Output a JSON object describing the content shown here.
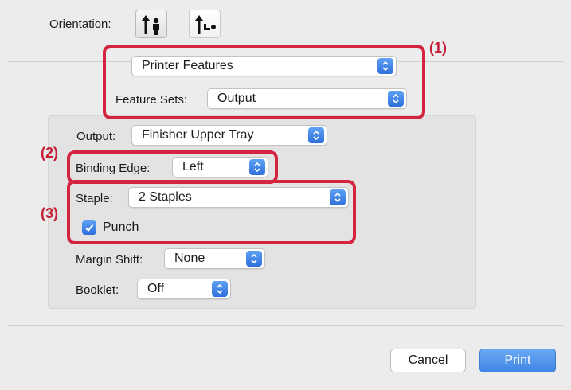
{
  "orientation": {
    "label": "Orientation:",
    "options": [
      {
        "icon": "portrait-orientation-icon",
        "selected": true
      },
      {
        "icon": "landscape-orientation-icon",
        "selected": false
      }
    ]
  },
  "top_section": {
    "panel_select": "Printer Features",
    "feature_sets": {
      "label": "Feature Sets:",
      "value": "Output"
    }
  },
  "group": {
    "output": {
      "label": "Output:",
      "value": "Finisher Upper Tray"
    },
    "binding_edge": {
      "label": "Binding Edge:",
      "value": "Left"
    },
    "staple": {
      "label": "Staple:",
      "value": "2 Staples"
    },
    "punch": {
      "label": "Punch",
      "checked": true
    },
    "margin_shift": {
      "label": "Margin Shift:",
      "value": "None"
    },
    "booklet": {
      "label": "Booklet:",
      "value": "Off"
    }
  },
  "callouts": {
    "one": "(1)",
    "two": "(2)",
    "three": "(3)"
  },
  "buttons": {
    "cancel": "Cancel",
    "print": "Print"
  },
  "colors": {
    "highlight": "#d5243f",
    "accent": "#3f85e6"
  }
}
